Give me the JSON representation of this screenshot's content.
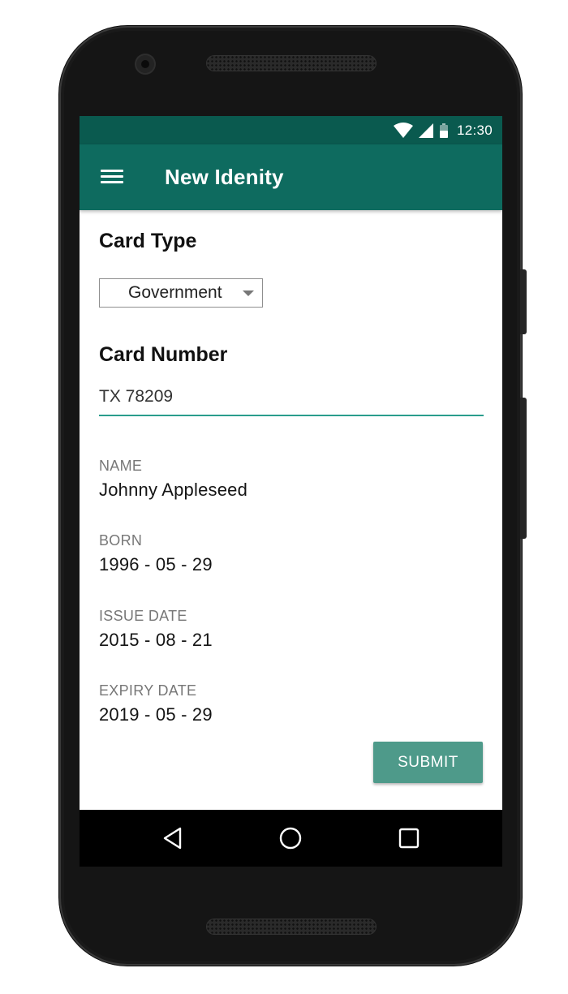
{
  "status_bar": {
    "time": "12:30",
    "icons": [
      "wifi-icon",
      "signal-icon",
      "battery-icon"
    ]
  },
  "app_bar": {
    "title": "New Idenity",
    "menu_icon": "menu-icon"
  },
  "form": {
    "card_type": {
      "label": "Card Type",
      "selected": "Government"
    },
    "card_number": {
      "label": "Card Number",
      "value": "TX 78209"
    },
    "fields": {
      "name": {
        "label": "NAME",
        "value": "Johnny Appleseed"
      },
      "born": {
        "label": "BORN",
        "value": "1996 - 05 - 29"
      },
      "issue_date": {
        "label": "ISSUE DATE",
        "value": "2015 - 08 - 21"
      },
      "expiry_date": {
        "label": "EXPIRY DATE",
        "value": "2019 - 05 - 29"
      }
    },
    "submit_label": "SUBMIT"
  },
  "nav_bar": {
    "icons": [
      "back-icon",
      "home-icon",
      "recent-apps-icon"
    ]
  },
  "colors": {
    "status_bar": "#0a5a4f",
    "app_bar": "#0e6b5f",
    "input_underline": "#2a9d8c",
    "submit_button": "#4e9a8a"
  }
}
